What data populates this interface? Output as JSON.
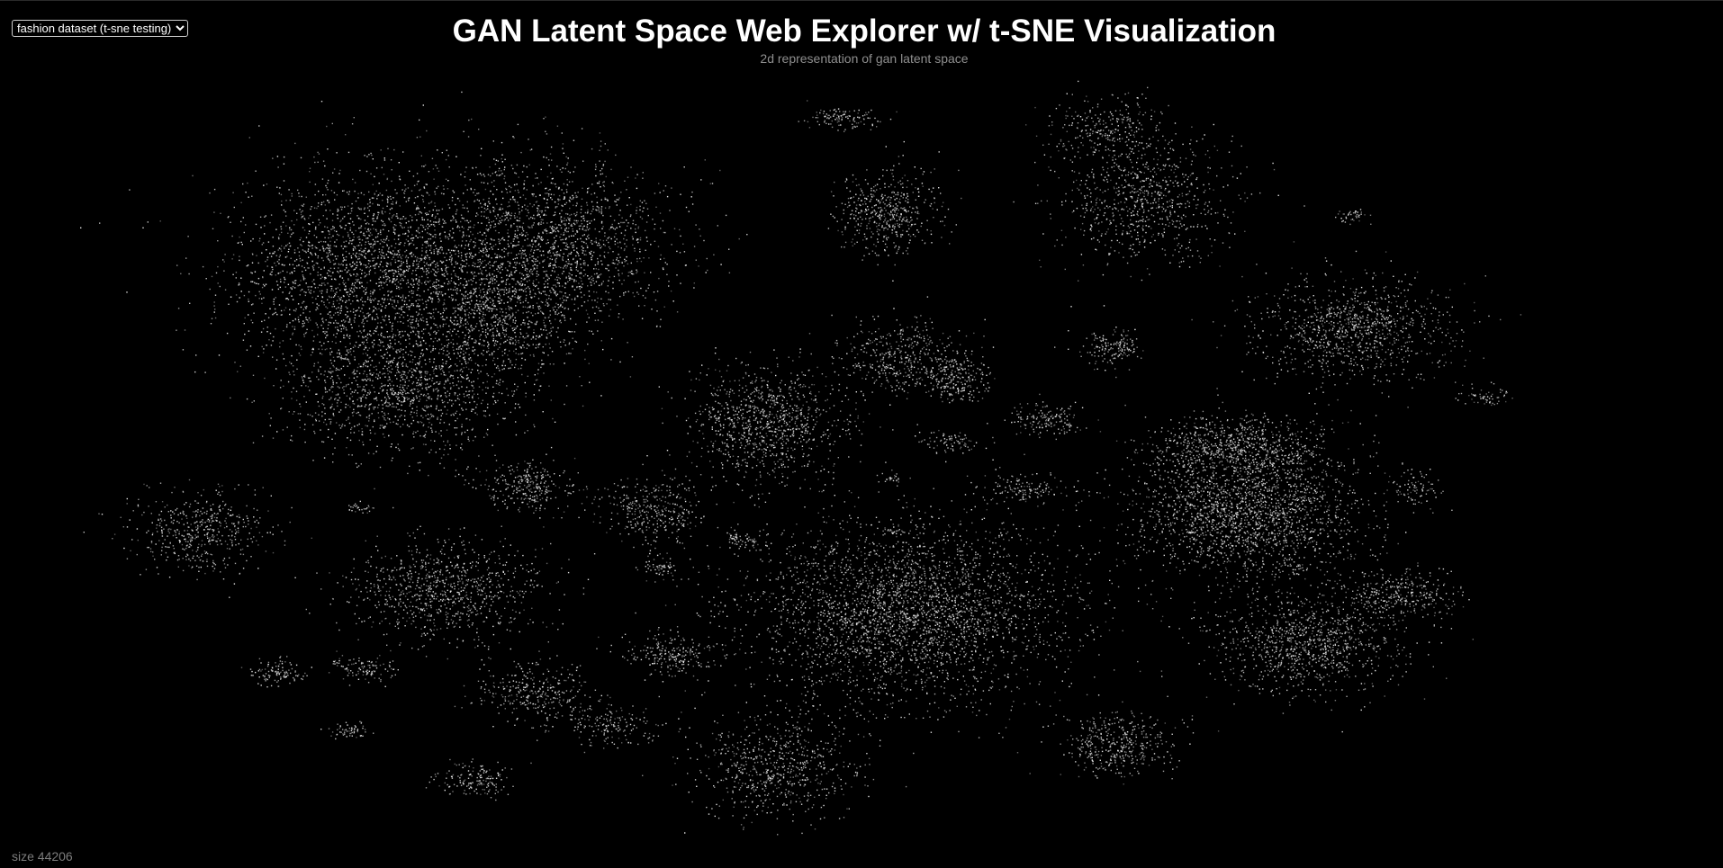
{
  "controls": {
    "dataset_select": {
      "selected": "fashion dataset (t-sne testing)",
      "options": [
        "fashion dataset (t-sne testing)"
      ]
    }
  },
  "header": {
    "title": "GAN Latent Space Web Explorer w/ t-SNE Visualization",
    "subtitle": "2d representation of gan latent space"
  },
  "status": {
    "size_text": "size 44206"
  },
  "colors": {
    "background": "#000000",
    "point": "#e8e8e8",
    "title": "#ffffff",
    "subtitle": "#8f8f8f",
    "status": "#7d7d7d"
  }
}
